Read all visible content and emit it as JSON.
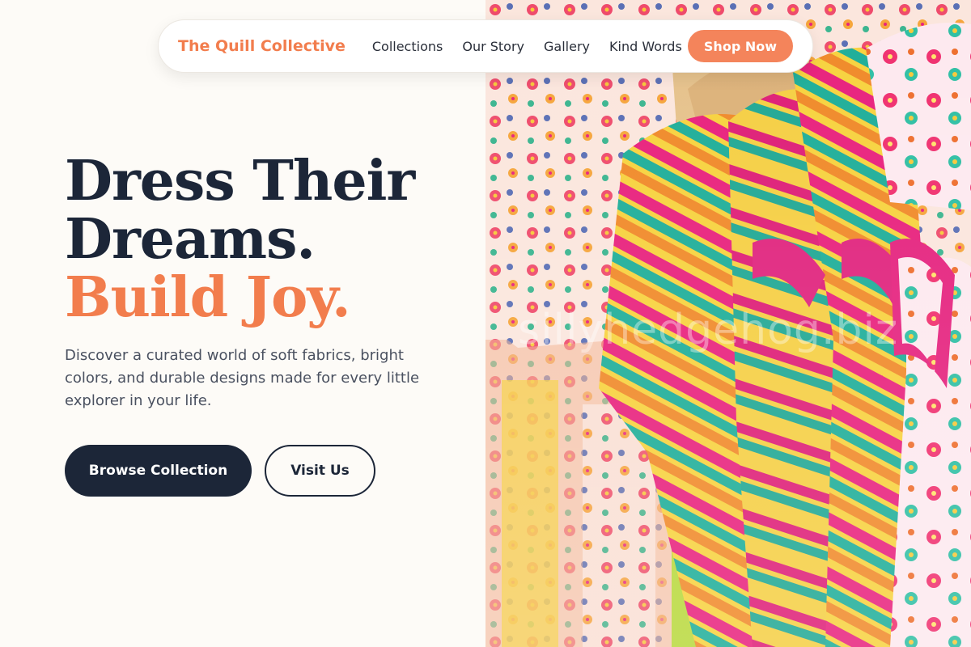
{
  "nav": {
    "brand": "The Quill Collective",
    "links": [
      "Collections",
      "Our Story",
      "Gallery",
      "Kind Words"
    ],
    "cta": "Shop Now"
  },
  "hero": {
    "headline_line1": "Dress Their",
    "headline_line2": "Dreams.",
    "headline_line3": "Build Joy.",
    "lead": "Discover a curated world of soft fabrics, bright colors, and durable designs made for every little explorer in your life.",
    "primary_button": "Browse Collection",
    "secondary_button": "Visit Us"
  },
  "image": {
    "watermark": "sillyhedgehog.biz"
  },
  "colors": {
    "accent": "#f27d4d",
    "dark": "#1c2638",
    "background": "#fdfbf7"
  }
}
